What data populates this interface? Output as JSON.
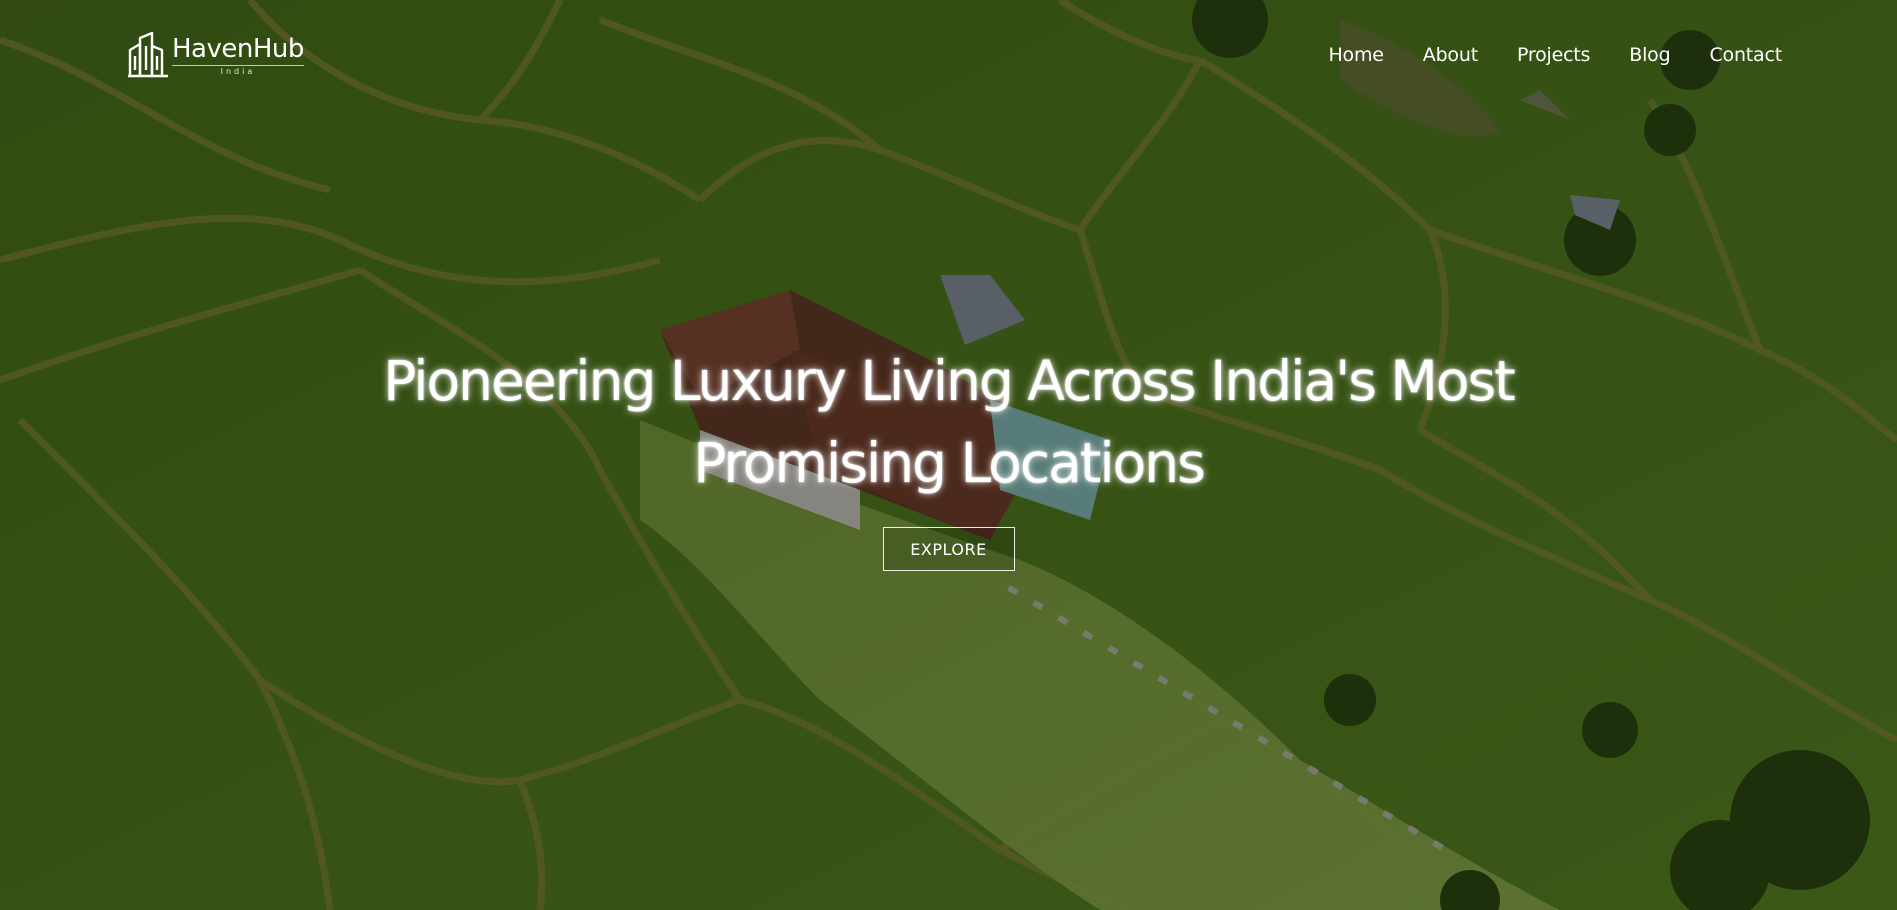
{
  "brand": {
    "name": "HavenHub",
    "tagline": "India"
  },
  "nav": {
    "items": [
      {
        "label": "Home"
      },
      {
        "label": "About"
      },
      {
        "label": "Projects"
      },
      {
        "label": "Blog"
      },
      {
        "label": "Contact"
      }
    ]
  },
  "hero": {
    "title_line1": "Pioneering Luxury Living Across India's Most",
    "title_line2": "Promising Locations",
    "cta_label": "EXPLORE",
    "background": "aerial-rice-terraces-villa-photo"
  },
  "colors": {
    "overlay": "#000000",
    "text": "#ffffff",
    "field_green": "#5b8a24"
  }
}
